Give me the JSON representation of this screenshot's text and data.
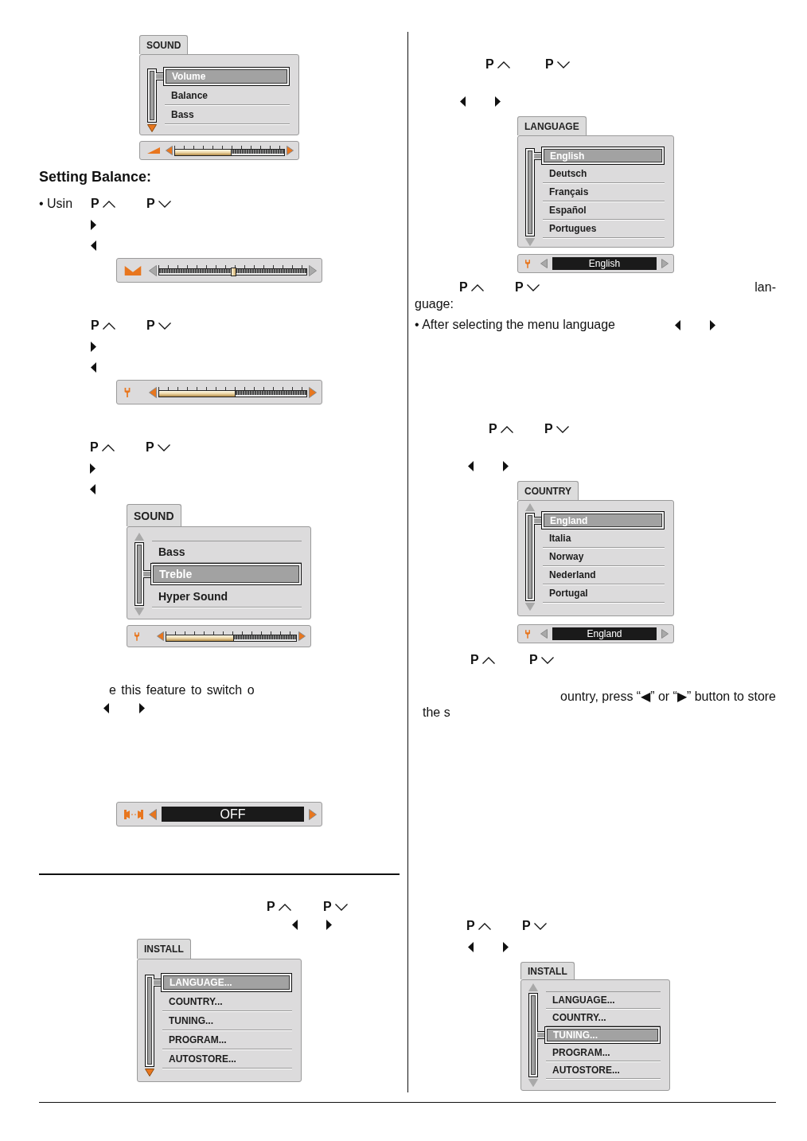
{
  "left_column": [
    {
      "kind": "menu",
      "title": "SOUND",
      "down_arrow_active": true,
      "items": [
        {
          "label": "Volume",
          "selected": true
        },
        {
          "label": "Balance",
          "selected": false
        },
        {
          "label": "Bass",
          "selected": false
        }
      ],
      "bar": {
        "kind": "volume",
        "active": true,
        "level": 0.52
      }
    },
    {
      "kind": "heading",
      "text": "Setting Balance:"
    },
    {
      "kind": "keys",
      "text_before": "• Usin",
      "up": "P",
      "down": "P"
    },
    {
      "kind": "arrows",
      "right": true
    },
    {
      "kind": "arrows",
      "left": true
    },
    {
      "kind": "bar",
      "bar": {
        "kind": "balance",
        "active": false,
        "level": 0.5
      }
    },
    {
      "kind": "keys",
      "up": "P",
      "down": "P"
    },
    {
      "kind": "arrows",
      "right": true
    },
    {
      "kind": "arrows",
      "left": true
    },
    {
      "kind": "bar",
      "bar": {
        "kind": "tone",
        "active": true,
        "level": 0.52
      }
    },
    {
      "kind": "keys",
      "up": "P",
      "down": "P"
    },
    {
      "kind": "arrows",
      "right": true
    },
    {
      "kind": "arrows",
      "left": true
    },
    {
      "kind": "menu",
      "title": "SOUND",
      "up_arrow": true,
      "down_arrow_active": false,
      "items": [
        {
          "label": "Bass",
          "selected": false
        },
        {
          "label": "Treble",
          "selected": true
        },
        {
          "label": "Hyper Sound",
          "selected": false
        }
      ],
      "bar": {
        "kind": "tone",
        "active": true,
        "level": 0.52
      }
    },
    {
      "kind": "text",
      "text": "e this feature to switch o"
    },
    {
      "kind": "arrows",
      "left": true,
      "right": true
    },
    {
      "kind": "bar",
      "bar": {
        "kind": "switch",
        "active": true,
        "value": "OFF"
      }
    },
    {
      "kind": "rule"
    },
    {
      "kind": "keys",
      "up": "P",
      "down": "P"
    },
    {
      "kind": "arrows",
      "left": true,
      "right": true
    },
    {
      "kind": "menu",
      "title": "INSTALL",
      "down_arrow_active": true,
      "items": [
        {
          "label": "LANGUAGE...",
          "selected": true
        },
        {
          "label": "COUNTRY...",
          "selected": false
        },
        {
          "label": "TUNING...",
          "selected": false
        },
        {
          "label": "PROGRAM...",
          "selected": false
        },
        {
          "label": "AUTOSTORE...",
          "selected": false
        }
      ]
    }
  ],
  "right_column": [
    {
      "kind": "keys",
      "up": "P",
      "down": "P"
    },
    {
      "kind": "arrows",
      "left": true,
      "right": true
    },
    {
      "kind": "menu",
      "title": "LANGUAGE",
      "down_arrow_active": false,
      "items": [
        {
          "label": "English",
          "selected": true
        },
        {
          "label": "Deutsch",
          "selected": false
        },
        {
          "label": "Français",
          "selected": false
        },
        {
          "label": "Español",
          "selected": false
        },
        {
          "label": "Portugues",
          "selected": false
        }
      ],
      "bar": {
        "kind": "option",
        "active": false,
        "value": "English"
      }
    },
    {
      "kind": "keys",
      "up": "P",
      "down": "P",
      "text_after": "lan-"
    },
    {
      "kind": "text",
      "text": "guage:"
    },
    {
      "kind": "arrows",
      "text_before": "• After selecting the menu language",
      "left": true,
      "right": true
    },
    {
      "kind": "keys",
      "up": "P",
      "down": "P"
    },
    {
      "kind": "arrows",
      "left": true,
      "right": true
    },
    {
      "kind": "menu",
      "title": "COUNTRY",
      "up_arrow": true,
      "down_arrow_active": false,
      "items": [
        {
          "label": "England",
          "selected": true
        },
        {
          "label": "Italia",
          "selected": false
        },
        {
          "label": "Norway",
          "selected": false
        },
        {
          "label": "Nederland",
          "selected": false
        },
        {
          "label": "Portugal",
          "selected": false
        }
      ],
      "bar": {
        "kind": "option",
        "active": false,
        "value": "England"
      }
    },
    {
      "kind": "keys",
      "up": "P",
      "down": "P"
    },
    {
      "kind": "text",
      "text": "ountry, press “◀” or “▶” button to store"
    },
    {
      "kind": "text",
      "text": "the s"
    },
    {
      "kind": "keys",
      "up": "P",
      "down": "P"
    },
    {
      "kind": "arrows",
      "left": true,
      "right": true
    },
    {
      "kind": "menu",
      "title": "INSTALL",
      "up_arrow": true,
      "down_arrow_active": false,
      "items": [
        {
          "label": "LANGUAGE...",
          "selected": false
        },
        {
          "label": "COUNTRY...",
          "selected": false
        },
        {
          "label": "TUNING...",
          "selected": true
        },
        {
          "label": "PROGRAM...",
          "selected": false
        },
        {
          "label": "AUTOSTORE...",
          "selected": false
        }
      ]
    }
  ]
}
